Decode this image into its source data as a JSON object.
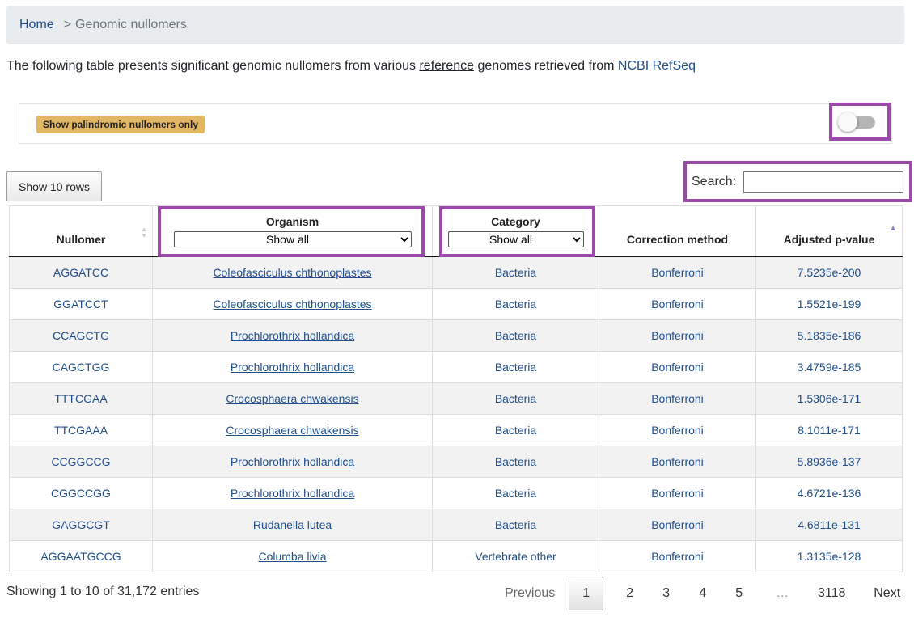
{
  "breadcrumb": {
    "home": "Home",
    "separator": ">",
    "current": "Genomic nullomers"
  },
  "intro": {
    "before": "The following table presents significant genomic nullomers from various ",
    "underlined": "reference",
    "middle": " genomes retrieved from ",
    "link": "NCBI RefSeq"
  },
  "filter": {
    "palindromic_label": "Show palindromic nullomers only",
    "toggle_on": false
  },
  "controls": {
    "show_rows_label": "Show 10 rows",
    "search_label": "Search:",
    "search_value": ""
  },
  "table": {
    "columns": {
      "nullomer": "Nullomer",
      "organism": "Organism",
      "category": "Category",
      "correction": "Correction method",
      "pvalue": "Adjusted p-value"
    },
    "organism_filter": "Show all",
    "category_filter": "Show all",
    "rows": [
      {
        "nullomer": "AGGATCC",
        "organism": "Coleofasciculus chthonoplastes",
        "category": "Bacteria",
        "correction": "Bonferroni",
        "pvalue": "7.5235e-200"
      },
      {
        "nullomer": "GGATCCT",
        "organism": "Coleofasciculus chthonoplastes",
        "category": "Bacteria",
        "correction": "Bonferroni",
        "pvalue": "1.5521e-199"
      },
      {
        "nullomer": "CCAGCTG",
        "organism": "Prochlorothrix hollandica",
        "category": "Bacteria",
        "correction": "Bonferroni",
        "pvalue": "5.1835e-186"
      },
      {
        "nullomer": "CAGCTGG",
        "organism": "Prochlorothrix hollandica",
        "category": "Bacteria",
        "correction": "Bonferroni",
        "pvalue": "3.4759e-185"
      },
      {
        "nullomer": "TTTCGAA",
        "organism": "Crocosphaera chwakensis",
        "category": "Bacteria",
        "correction": "Bonferroni",
        "pvalue": "1.5306e-171"
      },
      {
        "nullomer": "TTCGAAA",
        "organism": "Crocosphaera chwakensis",
        "category": "Bacteria",
        "correction": "Bonferroni",
        "pvalue": "8.1011e-171"
      },
      {
        "nullomer": "CCGGCCG",
        "organism": "Prochlorothrix hollandica",
        "category": "Bacteria",
        "correction": "Bonferroni",
        "pvalue": "5.8936e-137"
      },
      {
        "nullomer": "CGGCCGG",
        "organism": "Prochlorothrix hollandica",
        "category": "Bacteria",
        "correction": "Bonferroni",
        "pvalue": "4.6721e-136"
      },
      {
        "nullomer": "GAGGCGT",
        "organism": "Rudanella lutea",
        "category": "Bacteria",
        "correction": "Bonferroni",
        "pvalue": "4.6811e-131"
      },
      {
        "nullomer": "AGGAATGCCG",
        "organism": "Columba livia",
        "category": "Vertebrate other",
        "correction": "Bonferroni",
        "pvalue": "1.3135e-128"
      }
    ]
  },
  "info": "Showing 1 to 10 of 31,172 entries",
  "pagination": {
    "previous": "Previous",
    "current": "1",
    "pages": [
      "2",
      "3",
      "4",
      "5"
    ],
    "ellipsis": "…",
    "last": "3118",
    "next": "Next"
  },
  "icons": {
    "sort_both": "sort-both-icon",
    "sort_asc": "sort-ascending-icon",
    "chevron": "chevron-down-icon"
  },
  "colors": {
    "highlight": "#9c4aa9",
    "badge": "#e3b663",
    "link": "#1f4e8c"
  }
}
